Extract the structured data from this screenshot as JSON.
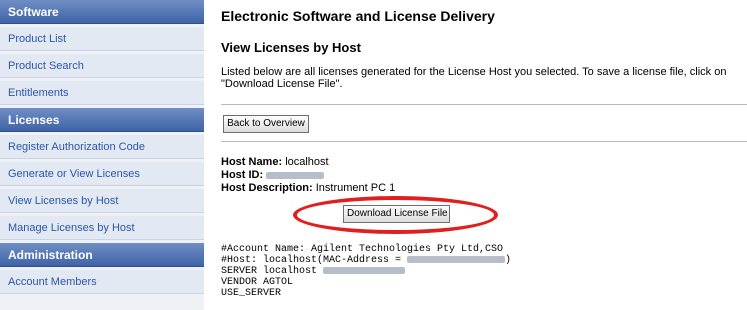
{
  "sidebar": {
    "sections": [
      {
        "title": "Software",
        "items": [
          "Product List",
          "Product Search",
          "Entitlements"
        ]
      },
      {
        "title": "Licenses",
        "items": [
          "Register Authorization Code",
          "Generate or View Licenses",
          "View Licenses by Host",
          "Manage Licenses by Host"
        ]
      },
      {
        "title": "Administration",
        "items": [
          "Account Members"
        ]
      }
    ]
  },
  "main": {
    "app_title": "Electronic Software and License Delivery",
    "page_title": "View Licenses by Host",
    "intro": "Listed below are all licenses generated for the License Host you selected. To save a license file, click on \"Download License File\".",
    "back_button": "Back to Overview",
    "host": {
      "name_label": "Host Name:",
      "name_value": "localhost",
      "id_label": "Host ID:",
      "description_label": "Host Description:",
      "description_value": "Instrument PC 1"
    },
    "download_button": "Download License File",
    "license_lines": {
      "account": "#Account Name: Agilent Technologies Pty Ltd,CSO",
      "host_prefix": "#Host: localhost(MAC-Address = ",
      "host_suffix": ")",
      "server_prefix": "SERVER localhost ",
      "vendor": "VENDOR AGTOL",
      "use_server": "USE_SERVER"
    }
  },
  "colors": {
    "section_header": "#3f63a6",
    "nav_text": "#2a56a8",
    "highlight_ellipse": "#e0201f"
  }
}
